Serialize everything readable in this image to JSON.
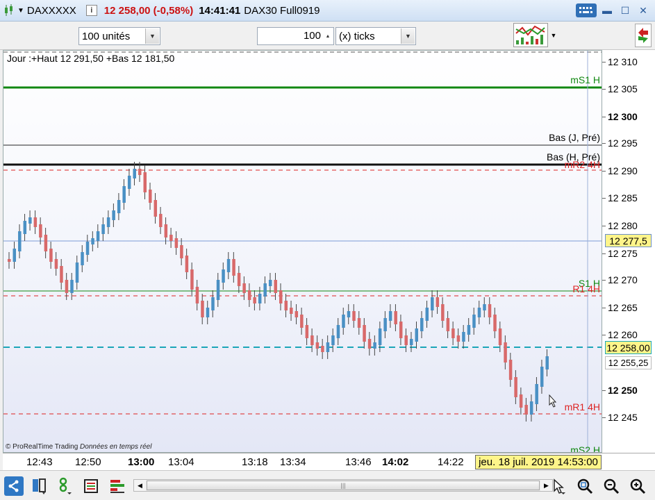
{
  "title_bar": {
    "symbol": "DAXXXXX",
    "info_label": "i",
    "price_change": "12 258,00 (-0,58%)",
    "time": "14:41:41",
    "contract": "DAX30 Full0919",
    "icons": [
      "candlestick-icon",
      "keyboard-icon",
      "minimize-icon",
      "maximize-icon",
      "close-icon"
    ]
  },
  "toolbar": {
    "units_select": "100 unités",
    "ticks_value": "100",
    "ticks_select": "(x) ticks"
  },
  "chart": {
    "caption": "Jour :+Haut 12 291,50 +Bas 12 181,50",
    "watermark_brand": "© ProRealTime Trading",
    "watermark_note": "Données en temps réel",
    "levels": {
      "ms1h": "mS1 H",
      "bas_j_pre": "Bas (J, Pré)",
      "bas_h_pre": "Bas (H, Pré)",
      "mr2_4h": "mR2 4H",
      "s1_h": "S1 H",
      "r1_4h": "R1 4H",
      "mr1_4h": "mR1 4H",
      "ms2_h": "mS2 H"
    },
    "colors": {
      "up": "#4a90c4",
      "down": "#d8696a",
      "support": "#118811",
      "resistance": "#dd2222",
      "price": "#1aa6b8"
    }
  },
  "y_axis": {
    "ticks": [
      {
        "label": "12 310",
        "bold": false
      },
      {
        "label": "12 305",
        "bold": false
      },
      {
        "label": "12 300",
        "bold": true
      },
      {
        "label": "12 295",
        "bold": false
      },
      {
        "label": "12 290",
        "bold": false
      },
      {
        "label": "12 285",
        "bold": false
      },
      {
        "label": "12 280",
        "bold": false
      },
      {
        "label": "12 275",
        "bold": false
      },
      {
        "label": "12 270",
        "bold": false
      },
      {
        "label": "12 265",
        "bold": false
      },
      {
        "label": "12 260",
        "bold": false
      },
      {
        "label": "12 250",
        "bold": true
      },
      {
        "label": "12 245",
        "bold": false
      }
    ],
    "crosshair_price": "12 277,5",
    "last_price": "12 258,00",
    "price_marker": "12 255,25"
  },
  "x_axis": {
    "ticks": [
      {
        "label": "12:43",
        "bold": false
      },
      {
        "label": "12:50",
        "bold": false
      },
      {
        "label": "13:00",
        "bold": true
      },
      {
        "label": "13:04",
        "bold": false
      },
      {
        "label": "13:18",
        "bold": false
      },
      {
        "label": "13:34",
        "bold": false
      },
      {
        "label": "13:46",
        "bold": false
      },
      {
        "label": "14:02",
        "bold": true
      },
      {
        "label": "14:22",
        "bold": false
      }
    ],
    "date_label": "jeu. 18 juil. 2019 14:53:00"
  },
  "bottom_bar": {
    "icons": [
      "share-icon",
      "layout-icon",
      "drawing-tools-icon",
      "list-icon",
      "bars-icon",
      "cursor-tool-icon",
      "zoom-fit-icon",
      "zoom-out-icon",
      "zoom-in-icon"
    ],
    "scroll_thumb": "|||"
  }
}
